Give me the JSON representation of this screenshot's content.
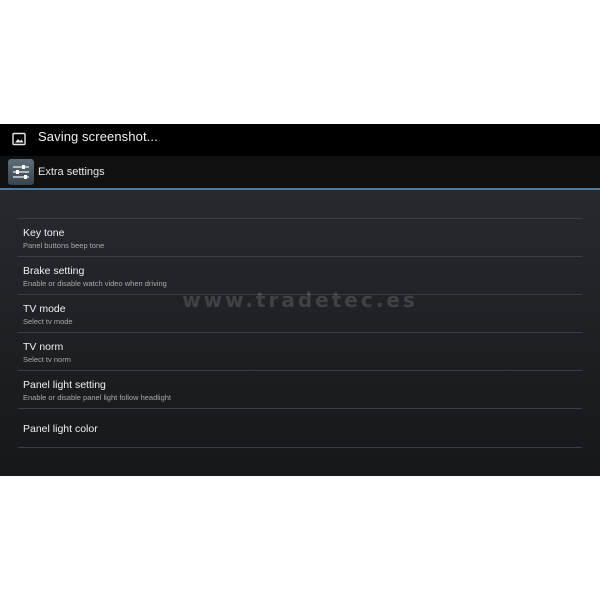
{
  "status_bar": {
    "notification_icon": "image-icon",
    "notification_text": "Saving screenshot..."
  },
  "action_bar": {
    "app_icon": "settings-sliders-icon",
    "title": "Extra settings"
  },
  "settings": [
    {
      "title": "Key tone",
      "summary": "Panel buttons beep tone"
    },
    {
      "title": "Brake setting",
      "summary": "Enable or disable watch video when driving"
    },
    {
      "title": "TV mode",
      "summary": "Select tv mode"
    },
    {
      "title": "TV norm",
      "summary": "Select tv norm"
    },
    {
      "title": "Panel light setting",
      "summary": "Enable or disable panel light follow headlight"
    },
    {
      "title": "Panel light color",
      "summary": ""
    }
  ],
  "watermark": "www.tradetec.es",
  "colors": {
    "screen_background": "#000000",
    "accent_divider": "#4f7aa0",
    "primary_text": "#f0f0f0",
    "secondary_text": "#a9a9a9"
  }
}
